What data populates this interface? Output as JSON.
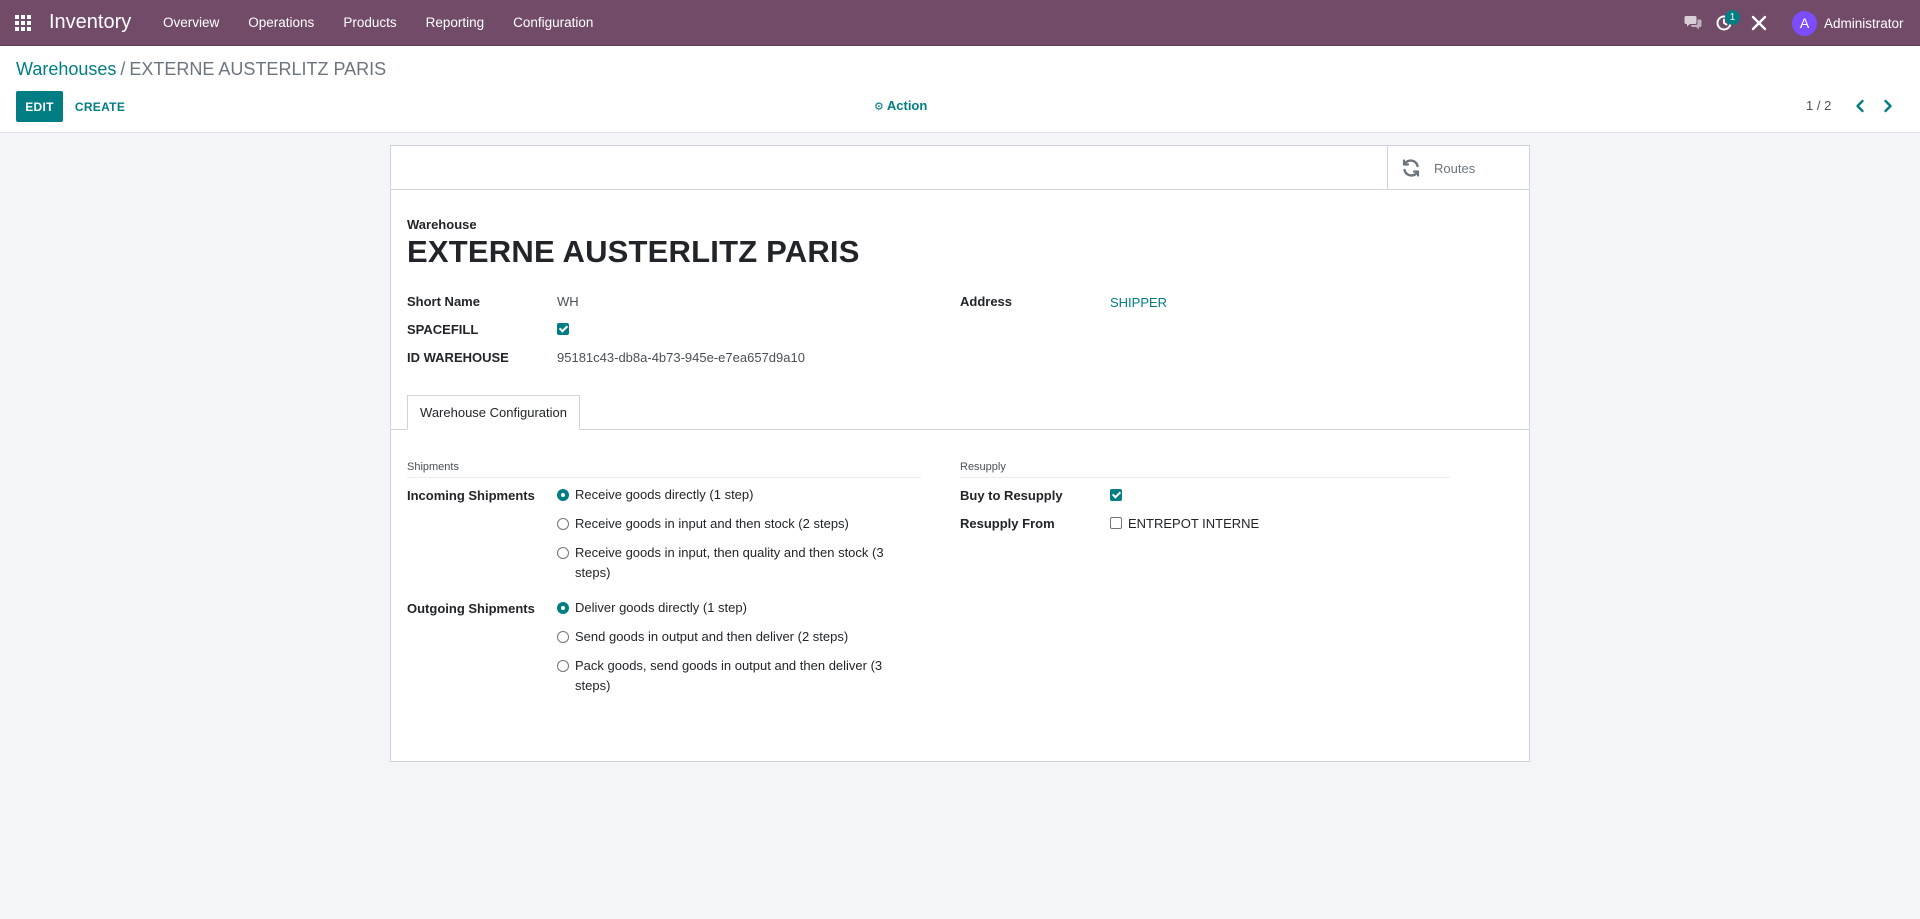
{
  "navbar": {
    "app_name": "Inventory",
    "menu": [
      "Overview",
      "Operations",
      "Products",
      "Reporting",
      "Configuration"
    ],
    "activity_count": "1",
    "avatar_initial": "A",
    "user_name": "Administrator",
    "bg_color": "#714b67"
  },
  "control_panel": {
    "breadcrumb_parent": "Warehouses",
    "breadcrumb_separator": "/",
    "breadcrumb_current": "EXTERNE AUSTERLITZ PARIS",
    "edit_label": "EDIT",
    "create_label": "CREATE",
    "action_label": "Action",
    "pager": "1 / 2"
  },
  "form": {
    "smart_button_routes": "Routes",
    "title_label": "Warehouse",
    "title": "EXTERNE AUSTERLITZ PARIS",
    "fields": {
      "short_name_label": "Short Name",
      "short_name": "WH",
      "spacefill_label": "SPACEFILL",
      "spacefill_checked": true,
      "id_warehouse_label": "ID WAREHOUSE",
      "id_warehouse": "95181c43-db8a-4b73-945e-e7ea657d9a10",
      "address_label": "Address",
      "address": "SHIPPER"
    },
    "tab_label": "Warehouse Configuration",
    "shipments": {
      "group_title": "Shipments",
      "incoming_label": "Incoming Shipments",
      "incoming_options": [
        "Receive goods directly (1 step)",
        "Receive goods in input and then stock (2 steps)",
        "Receive goods in input, then quality and then stock (3 steps)"
      ],
      "incoming_selected": 0,
      "outgoing_label": "Outgoing Shipments",
      "outgoing_options": [
        "Deliver goods directly (1 step)",
        "Send goods in output and then deliver (2 steps)",
        "Pack goods, send goods in output and then deliver (3 steps)"
      ],
      "outgoing_selected": 0
    },
    "resupply": {
      "group_title": "Resupply",
      "buy_label": "Buy to Resupply",
      "buy_checked": true,
      "resupply_from_label": "Resupply From",
      "resupply_from_option": "ENTREPOT INTERNE",
      "resupply_from_checked": false
    }
  },
  "colors": {
    "accent": "#017e84",
    "background": "#f4f5f8"
  }
}
